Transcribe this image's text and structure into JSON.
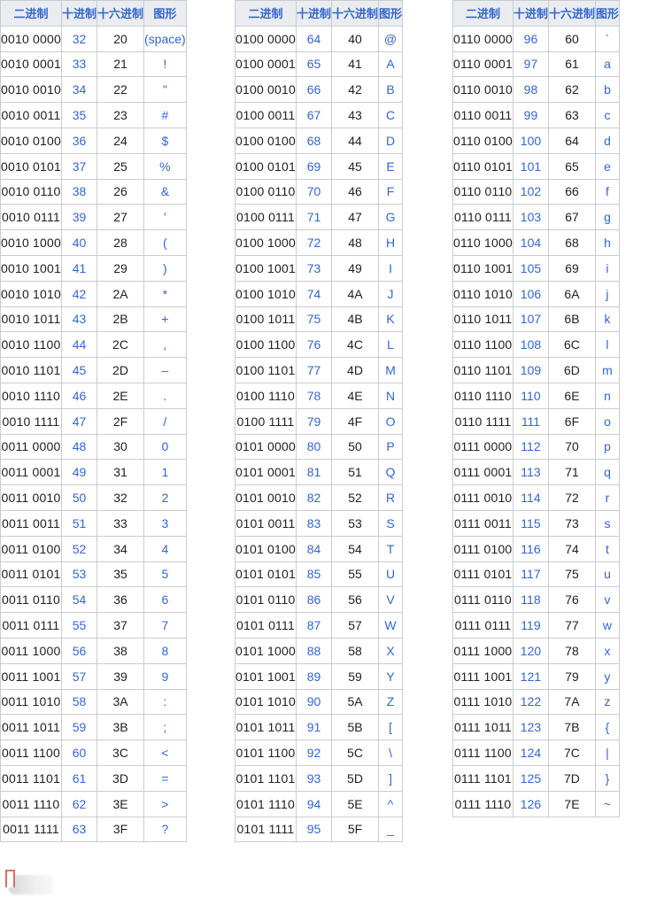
{
  "headers": {
    "binary": "二进制",
    "decimal": "十进制",
    "hex": "十六进制",
    "glyph": "图形"
  },
  "tables": [
    {
      "rows": [
        {
          "bin": "0010 0000",
          "dec": "32",
          "hex": "20",
          "glyph": "(space)"
        },
        {
          "bin": "0010 0001",
          "dec": "33",
          "hex": "21",
          "glyph": "!"
        },
        {
          "bin": "0010 0010",
          "dec": "34",
          "hex": "22",
          "glyph": "\""
        },
        {
          "bin": "0010 0011",
          "dec": "35",
          "hex": "23",
          "glyph": "#"
        },
        {
          "bin": "0010 0100",
          "dec": "36",
          "hex": "24",
          "glyph": "$"
        },
        {
          "bin": "0010 0101",
          "dec": "37",
          "hex": "25",
          "glyph": "%"
        },
        {
          "bin": "0010 0110",
          "dec": "38",
          "hex": "26",
          "glyph": "&"
        },
        {
          "bin": "0010 0111",
          "dec": "39",
          "hex": "27",
          "glyph": "'"
        },
        {
          "bin": "0010 1000",
          "dec": "40",
          "hex": "28",
          "glyph": "("
        },
        {
          "bin": "0010 1001",
          "dec": "41",
          "hex": "29",
          "glyph": ")"
        },
        {
          "bin": "0010 1010",
          "dec": "42",
          "hex": "2A",
          "glyph": "*"
        },
        {
          "bin": "0010 1011",
          "dec": "43",
          "hex": "2B",
          "glyph": "+"
        },
        {
          "bin": "0010 1100",
          "dec": "44",
          "hex": "2C",
          "glyph": ","
        },
        {
          "bin": "0010 1101",
          "dec": "45",
          "hex": "2D",
          "glyph": "–"
        },
        {
          "bin": "0010 1110",
          "dec": "46",
          "hex": "2E",
          "glyph": "."
        },
        {
          "bin": "0010 1111",
          "dec": "47",
          "hex": "2F",
          "glyph": "/"
        },
        {
          "bin": "0011 0000",
          "dec": "48",
          "hex": "30",
          "glyph": "0"
        },
        {
          "bin": "0011 0001",
          "dec": "49",
          "hex": "31",
          "glyph": "1"
        },
        {
          "bin": "0011 0010",
          "dec": "50",
          "hex": "32",
          "glyph": "2"
        },
        {
          "bin": "0011 0011",
          "dec": "51",
          "hex": "33",
          "glyph": "3"
        },
        {
          "bin": "0011 0100",
          "dec": "52",
          "hex": "34",
          "glyph": "4"
        },
        {
          "bin": "0011 0101",
          "dec": "53",
          "hex": "35",
          "glyph": "5"
        },
        {
          "bin": "0011 0110",
          "dec": "54",
          "hex": "36",
          "glyph": "6"
        },
        {
          "bin": "0011 0111",
          "dec": "55",
          "hex": "37",
          "glyph": "7"
        },
        {
          "bin": "0011 1000",
          "dec": "56",
          "hex": "38",
          "glyph": "8"
        },
        {
          "bin": "0011 1001",
          "dec": "57",
          "hex": "39",
          "glyph": "9"
        },
        {
          "bin": "0011 1010",
          "dec": "58",
          "hex": "3A",
          "glyph": ":"
        },
        {
          "bin": "0011 1011",
          "dec": "59",
          "hex": "3B",
          "glyph": ";"
        },
        {
          "bin": "0011 1100",
          "dec": "60",
          "hex": "3C",
          "glyph": "<"
        },
        {
          "bin": "0011 1101",
          "dec": "61",
          "hex": "3D",
          "glyph": "="
        },
        {
          "bin": "0011 1110",
          "dec": "62",
          "hex": "3E",
          "glyph": ">"
        },
        {
          "bin": "0011 1111",
          "dec": "63",
          "hex": "3F",
          "glyph": "?"
        }
      ]
    },
    {
      "rows": [
        {
          "bin": "0100 0000",
          "dec": "64",
          "hex": "40",
          "glyph": "@"
        },
        {
          "bin": "0100 0001",
          "dec": "65",
          "hex": "41",
          "glyph": "A"
        },
        {
          "bin": "0100 0010",
          "dec": "66",
          "hex": "42",
          "glyph": "B"
        },
        {
          "bin": "0100 0011",
          "dec": "67",
          "hex": "43",
          "glyph": "C"
        },
        {
          "bin": "0100 0100",
          "dec": "68",
          "hex": "44",
          "glyph": "D"
        },
        {
          "bin": "0100 0101",
          "dec": "69",
          "hex": "45",
          "glyph": "E"
        },
        {
          "bin": "0100 0110",
          "dec": "70",
          "hex": "46",
          "glyph": "F"
        },
        {
          "bin": "0100 0111",
          "dec": "71",
          "hex": "47",
          "glyph": "G"
        },
        {
          "bin": "0100 1000",
          "dec": "72",
          "hex": "48",
          "glyph": "H"
        },
        {
          "bin": "0100 1001",
          "dec": "73",
          "hex": "49",
          "glyph": "I"
        },
        {
          "bin": "0100 1010",
          "dec": "74",
          "hex": "4A",
          "glyph": "J"
        },
        {
          "bin": "0100 1011",
          "dec": "75",
          "hex": "4B",
          "glyph": "K"
        },
        {
          "bin": "0100 1100",
          "dec": "76",
          "hex": "4C",
          "glyph": "L"
        },
        {
          "bin": "0100 1101",
          "dec": "77",
          "hex": "4D",
          "glyph": "M"
        },
        {
          "bin": "0100 1110",
          "dec": "78",
          "hex": "4E",
          "glyph": "N"
        },
        {
          "bin": "0100 1111",
          "dec": "79",
          "hex": "4F",
          "glyph": "O"
        },
        {
          "bin": "0101 0000",
          "dec": "80",
          "hex": "50",
          "glyph": "P"
        },
        {
          "bin": "0101 0001",
          "dec": "81",
          "hex": "51",
          "glyph": "Q"
        },
        {
          "bin": "0101 0010",
          "dec": "82",
          "hex": "52",
          "glyph": "R"
        },
        {
          "bin": "0101 0011",
          "dec": "83",
          "hex": "53",
          "glyph": "S"
        },
        {
          "bin": "0101 0100",
          "dec": "84",
          "hex": "54",
          "glyph": "T"
        },
        {
          "bin": "0101 0101",
          "dec": "85",
          "hex": "55",
          "glyph": "U"
        },
        {
          "bin": "0101 0110",
          "dec": "86",
          "hex": "56",
          "glyph": "V"
        },
        {
          "bin": "0101 0111",
          "dec": "87",
          "hex": "57",
          "glyph": "W"
        },
        {
          "bin": "0101 1000",
          "dec": "88",
          "hex": "58",
          "glyph": "X"
        },
        {
          "bin": "0101 1001",
          "dec": "89",
          "hex": "59",
          "glyph": "Y"
        },
        {
          "bin": "0101 1010",
          "dec": "90",
          "hex": "5A",
          "glyph": "Z"
        },
        {
          "bin": "0101 1011",
          "dec": "91",
          "hex": "5B",
          "glyph": "["
        },
        {
          "bin": "0101 1100",
          "dec": "92",
          "hex": "5C",
          "glyph": "\\"
        },
        {
          "bin": "0101 1101",
          "dec": "93",
          "hex": "5D",
          "glyph": "]"
        },
        {
          "bin": "0101 1110",
          "dec": "94",
          "hex": "5E",
          "glyph": "^"
        },
        {
          "bin": "0101 1111",
          "dec": "95",
          "hex": "5F",
          "glyph": "_"
        }
      ]
    },
    {
      "rows": [
        {
          "bin": "0110 0000",
          "dec": "96",
          "hex": "60",
          "glyph": "`"
        },
        {
          "bin": "0110 0001",
          "dec": "97",
          "hex": "61",
          "glyph": "a"
        },
        {
          "bin": "0110 0010",
          "dec": "98",
          "hex": "62",
          "glyph": "b"
        },
        {
          "bin": "0110 0011",
          "dec": "99",
          "hex": "63",
          "glyph": "c"
        },
        {
          "bin": "0110 0100",
          "dec": "100",
          "hex": "64",
          "glyph": "d"
        },
        {
          "bin": "0110 0101",
          "dec": "101",
          "hex": "65",
          "glyph": "e"
        },
        {
          "bin": "0110 0110",
          "dec": "102",
          "hex": "66",
          "glyph": "f"
        },
        {
          "bin": "0110 0111",
          "dec": "103",
          "hex": "67",
          "glyph": "g"
        },
        {
          "bin": "0110 1000",
          "dec": "104",
          "hex": "68",
          "glyph": "h"
        },
        {
          "bin": "0110 1001",
          "dec": "105",
          "hex": "69",
          "glyph": "i"
        },
        {
          "bin": "0110 1010",
          "dec": "106",
          "hex": "6A",
          "glyph": "j"
        },
        {
          "bin": "0110 1011",
          "dec": "107",
          "hex": "6B",
          "glyph": "k"
        },
        {
          "bin": "0110 1100",
          "dec": "108",
          "hex": "6C",
          "glyph": "l"
        },
        {
          "bin": "0110 1101",
          "dec": "109",
          "hex": "6D",
          "glyph": "m"
        },
        {
          "bin": "0110 1110",
          "dec": "110",
          "hex": "6E",
          "glyph": "n"
        },
        {
          "bin": "0110 1111",
          "dec": "111",
          "hex": "6F",
          "glyph": "o"
        },
        {
          "bin": "0111 0000",
          "dec": "112",
          "hex": "70",
          "glyph": "p"
        },
        {
          "bin": "0111 0001",
          "dec": "113",
          "hex": "71",
          "glyph": "q"
        },
        {
          "bin": "0111 0010",
          "dec": "114",
          "hex": "72",
          "glyph": "r"
        },
        {
          "bin": "0111 0011",
          "dec": "115",
          "hex": "73",
          "glyph": "s"
        },
        {
          "bin": "0111 0100",
          "dec": "116",
          "hex": "74",
          "glyph": "t"
        },
        {
          "bin": "0111 0101",
          "dec": "117",
          "hex": "75",
          "glyph": "u"
        },
        {
          "bin": "0111 0110",
          "dec": "118",
          "hex": "76",
          "glyph": "v"
        },
        {
          "bin": "0111 0111",
          "dec": "119",
          "hex": "77",
          "glyph": "w"
        },
        {
          "bin": "0111 1000",
          "dec": "120",
          "hex": "78",
          "glyph": "x"
        },
        {
          "bin": "0111 1001",
          "dec": "121",
          "hex": "79",
          "glyph": "y"
        },
        {
          "bin": "0111 1010",
          "dec": "122",
          "hex": "7A",
          "glyph": "z"
        },
        {
          "bin": "0111 1011",
          "dec": "123",
          "hex": "7B",
          "glyph": "{"
        },
        {
          "bin": "0111 1100",
          "dec": "124",
          "hex": "7C",
          "glyph": "|"
        },
        {
          "bin": "0111 1101",
          "dec": "125",
          "hex": "7D",
          "glyph": "}"
        },
        {
          "bin": "0111 1110",
          "dec": "126",
          "hex": "7E",
          "glyph": "~"
        }
      ]
    }
  ]
}
